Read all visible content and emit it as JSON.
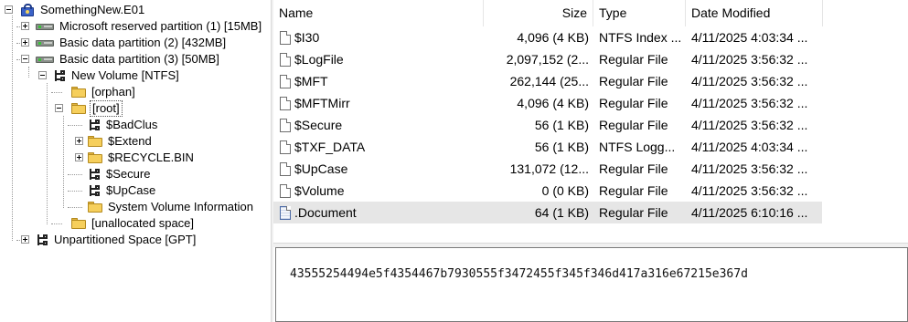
{
  "tree": {
    "root": "SomethingNew.E01",
    "partitions": [
      "Microsoft reserved partition (1) [15MB]",
      "Basic data partition (2) [432MB]",
      "Basic data partition (3) [50MB]"
    ],
    "volume": "New Volume [NTFS]",
    "volume_children": [
      "[orphan]",
      "[root]",
      "[unallocated space]"
    ],
    "root_children": [
      "$BadClus",
      "$Extend",
      "$RECYCLE.BIN",
      "$Secure",
      "$UpCase",
      "System Volume Information"
    ],
    "unpartitioned": "Unpartitioned Space [GPT]",
    "selected": "[root]"
  },
  "filelist": {
    "columns": {
      "name": "Name",
      "size": "Size",
      "type": "Type",
      "date": "Date Modified"
    },
    "rows": [
      {
        "name": "$I30",
        "size": "4,096 (4 KB)",
        "type": "NTFS Index ...",
        "date": "4/11/2025 4:03:34 ...",
        "icon": "file-icon"
      },
      {
        "name": "$LogFile",
        "size": "2,097,152 (2...",
        "type": "Regular File",
        "date": "4/11/2025 3:56:32 ...",
        "icon": "file-icon"
      },
      {
        "name": "$MFT",
        "size": "262,144 (25...",
        "type": "Regular File",
        "date": "4/11/2025 3:56:32 ...",
        "icon": "file-icon"
      },
      {
        "name": "$MFTMirr",
        "size": "4,096 (4 KB)",
        "type": "Regular File",
        "date": "4/11/2025 3:56:32 ...",
        "icon": "file-icon"
      },
      {
        "name": "$Secure",
        "size": "56 (1 KB)",
        "type": "Regular File",
        "date": "4/11/2025 3:56:32 ...",
        "icon": "file-icon"
      },
      {
        "name": "$TXF_DATA",
        "size": "56 (1 KB)",
        "type": "NTFS Logg...",
        "date": "4/11/2025 4:03:34 ...",
        "icon": "file-icon"
      },
      {
        "name": "$UpCase",
        "size": "131,072 (12...",
        "type": "Regular File",
        "date": "4/11/2025 3:56:32 ...",
        "icon": "file-icon"
      },
      {
        "name": "$Volume",
        "size": "0 (0 KB)",
        "type": "Regular File",
        "date": "4/11/2025 3:56:32 ...",
        "icon": "file-icon"
      },
      {
        "name": ".Document",
        "size": "64 (1 KB)",
        "type": "Regular File",
        "date": "4/11/2025 6:10:16 ...",
        "icon": "document-file-icon",
        "selected": true
      }
    ]
  },
  "content": {
    "text": "43555254494e5f4354467b7930555f3472455f345f346d417a316e67215e367d"
  }
}
